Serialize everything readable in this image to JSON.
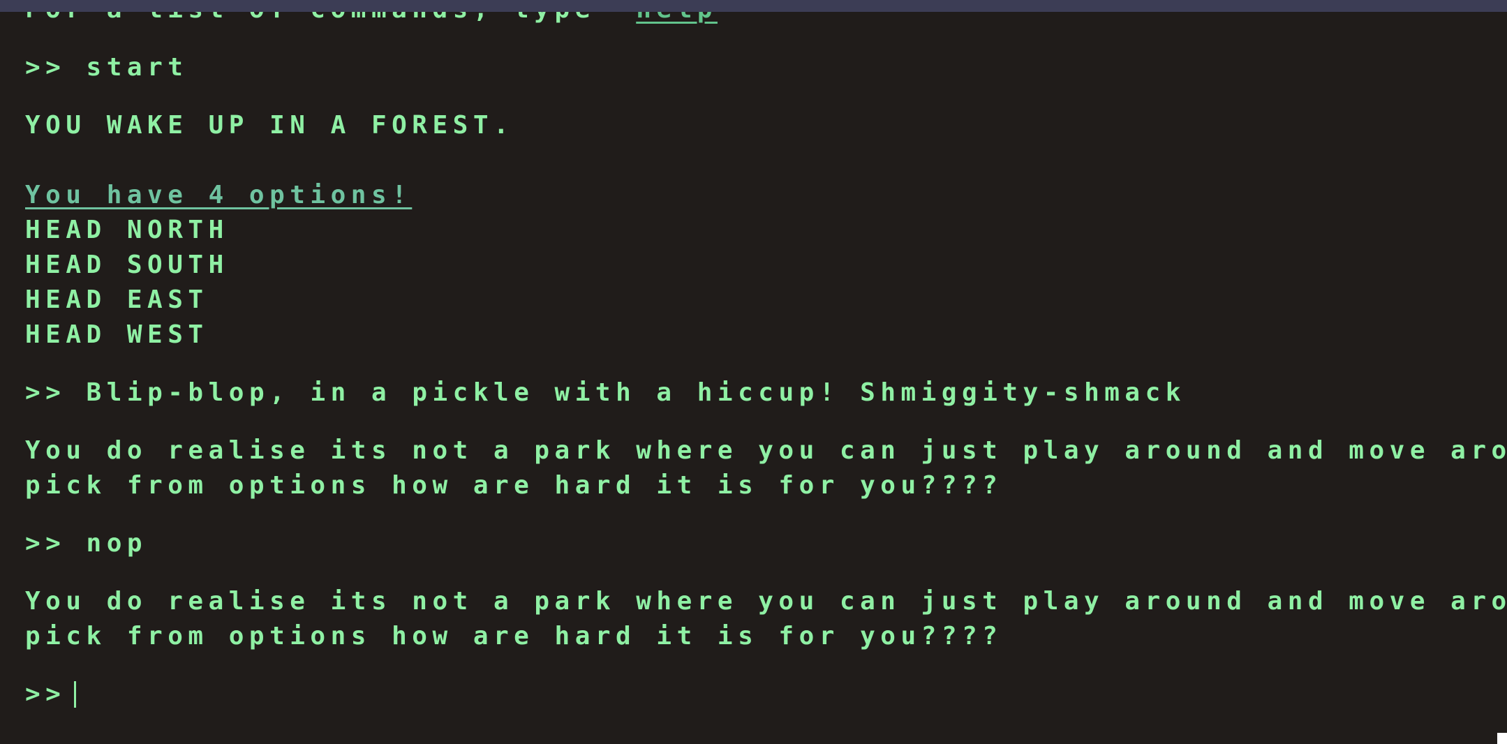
{
  "terminal": {
    "help_text": "For a list of commands, type ",
    "help_command": "help",
    "prompt_symbol": ">>",
    "entries": {
      "cmd1": "start",
      "intro": "YOU WAKE UP IN A FOREST.",
      "options_heading": "You have 4 options!",
      "options": [
        "HEAD NORTH",
        "HEAD SOUTH",
        "HEAD EAST",
        "HEAD WEST"
      ],
      "cmd2": "Blip-blop, in a pickle with a hiccup! Shmiggity-shmack",
      "response2_line1": "You do realise its not a park where you can just play around and move around",
      "response2_line2": "pick from options how are hard it is for you????",
      "cmd3": "nop",
      "response3_line1": "You do realise its not a park where you can just play around and move around",
      "response3_line2": "pick from options how are hard it is for you????"
    },
    "input_value": ""
  },
  "colors": {
    "background": "#201c1a",
    "text": "#8ff0a4",
    "topbar": "#3c3d55"
  }
}
